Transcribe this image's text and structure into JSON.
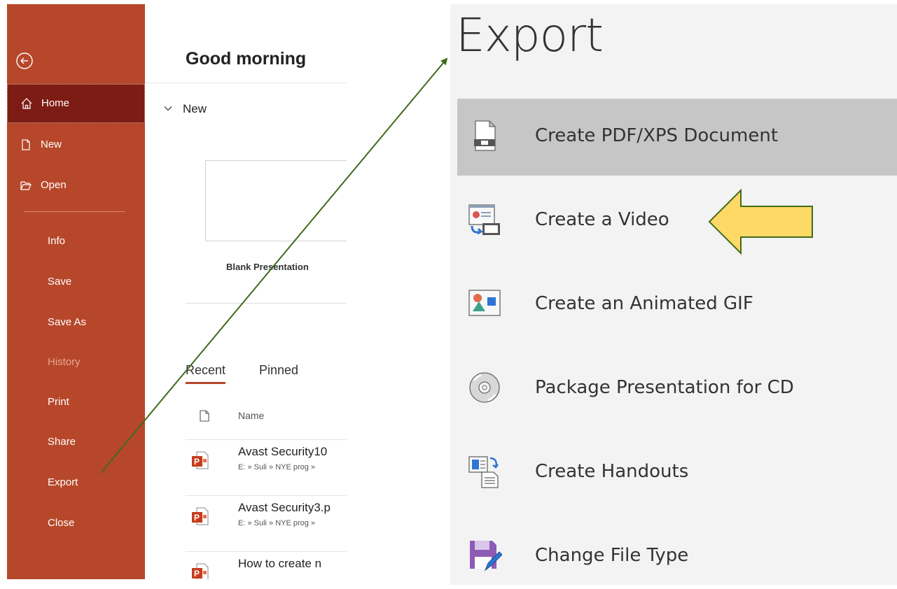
{
  "sidebar": {
    "back_label": "",
    "items": [
      {
        "label": "Home",
        "icon": "home-icon",
        "active": true
      },
      {
        "label": "New",
        "icon": "new-file-icon"
      },
      {
        "label": "Open",
        "icon": "folder-open-icon"
      },
      {
        "label": "Info"
      },
      {
        "label": "Save"
      },
      {
        "label": "Save As"
      },
      {
        "label": "History",
        "disabled": true
      },
      {
        "label": "Print"
      },
      {
        "label": "Share"
      },
      {
        "label": "Export"
      },
      {
        "label": "Close"
      }
    ]
  },
  "main": {
    "greeting": "Good morning",
    "new_section": "New",
    "blank_presentation": "Blank Presentation",
    "tabs": [
      "Recent",
      "Pinned"
    ],
    "name_header": "Name",
    "files": [
      {
        "name": "Avast Security10",
        "path": "E: » Suli » NYE prog »"
      },
      {
        "name": "Avast Security3.p",
        "path": "E: » Suli » NYE prog »"
      },
      {
        "name": "How to create n",
        "path": ""
      }
    ]
  },
  "export": {
    "title": "Export",
    "items": [
      {
        "label": "Create PDF/XPS Document",
        "icon": "pdf-document-icon",
        "selected": true
      },
      {
        "label": "Create a Video",
        "icon": "video-icon"
      },
      {
        "label": "Create an Animated GIF",
        "icon": "animated-gif-icon"
      },
      {
        "label": "Package Presentation for CD",
        "icon": "cd-icon"
      },
      {
        "label": "Create Handouts",
        "icon": "handouts-icon"
      },
      {
        "label": "Change File Type",
        "icon": "save-disk-icon"
      }
    ]
  },
  "colors": {
    "sidebar_bg": "#b7472a",
    "sidebar_active": "#7d1c14",
    "arrow_line": "#3f6b1a",
    "callout_fill": "#ffd966",
    "callout_stroke": "#3f6b1a"
  }
}
